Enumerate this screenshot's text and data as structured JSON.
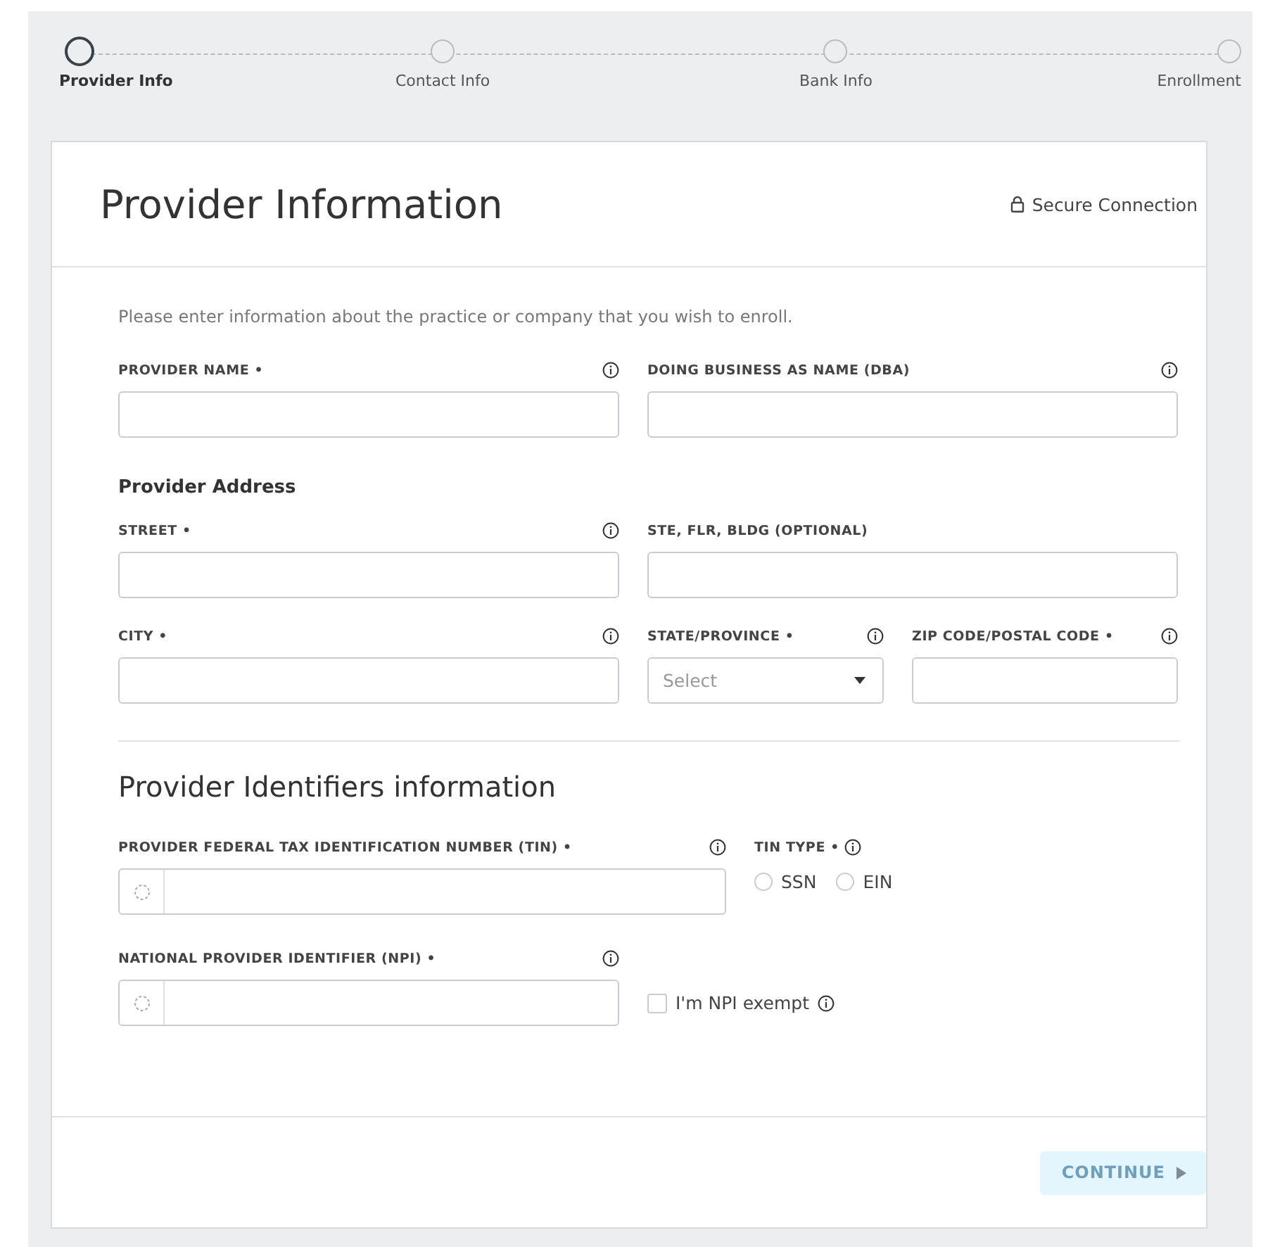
{
  "steps": [
    {
      "label": "Provider Info",
      "selected": true
    },
    {
      "label": "Contact Info",
      "selected": false
    },
    {
      "label": "Bank Info",
      "selected": false
    },
    {
      "label": "Enrollment",
      "selected": false
    }
  ],
  "header": {
    "title": "Provider Information",
    "secure": "Secure Connection"
  },
  "intro": "Please enter information about the practice or company that you wish to enroll.",
  "business": [
    {
      "label": "PROVIDER NAME •",
      "info": true
    },
    {
      "label": "DOING BUSINESS AS NAME (DBA)",
      "info": true
    }
  ],
  "address": {
    "heading": "Provider Address",
    "fields": [
      {
        "kind": "text",
        "label": "STREET •",
        "info": true
      },
      {
        "kind": "text",
        "label": "STE, FLR, BLDG (OPTIONAL)",
        "info": false
      },
      {
        "kind": "text",
        "label": "CITY •",
        "info": true
      },
      {
        "kind": "select",
        "label": "STATE/PROVINCE •",
        "info": true,
        "placeholder": "Select"
      },
      {
        "kind": "text",
        "label": "ZIP CODE/POSTAL CODE •",
        "info": true
      }
    ]
  },
  "identifiers": {
    "heading": "Provider Identifiers information",
    "tin": {
      "label": "PROVIDER FEDERAL TAX IDENTIFICATION NUMBER (TIN) •",
      "info": true
    },
    "tin_type": {
      "label": "TIN TYPE •",
      "info": true,
      "options": [
        {
          "label": "SSN",
          "selected": false
        },
        {
          "label": "EIN",
          "selected": false
        }
      ]
    },
    "npi": {
      "label": "NATIONAL PROVIDER IDENTIFIER (NPI) •",
      "info": true
    },
    "npi_exempt": {
      "label": "I'm NPI exempt",
      "checked": false,
      "info": true
    }
  },
  "continue": {
    "label": "CONTINUE",
    "disabled": true
  }
}
